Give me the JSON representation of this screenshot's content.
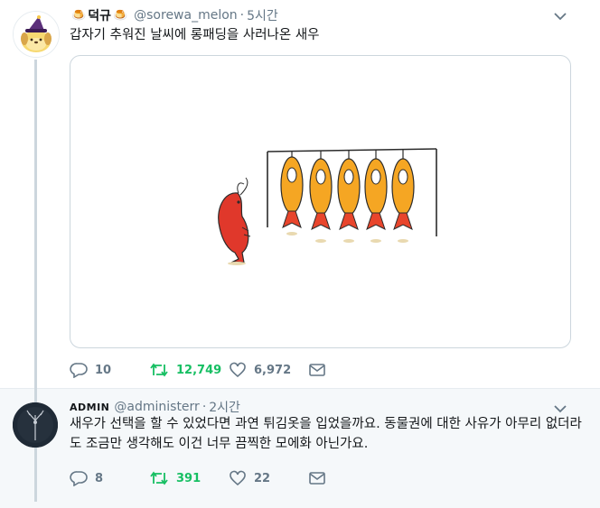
{
  "tweet1": {
    "emoji_left": "🍮",
    "name": "덕규",
    "emoji_right": "🍮",
    "handle": "@sorewa_melon",
    "separator": "·",
    "time": "5시간",
    "text": "갑자기 추워진 날씨에 롱패딩을 사러나온 새우",
    "replies": "10",
    "retweets": "12,749",
    "likes": "6,972",
    "retweet_color": "#17bf63"
  },
  "tweet2": {
    "name": "ADMIN",
    "handle": "@administerr",
    "separator": "·",
    "time": "2시간",
    "text": "새우가 선택을 할 수 있었다면 과연 튀김옷을 입었을까요. 동물권에 대한 사유가 아무리 없더라도 조금만 생각해도 이건 너무 끔찍한 모에화 아닌가요.",
    "replies": "8",
    "retweets": "391",
    "likes": "22"
  },
  "colors": {
    "accent_green": "#17bf63",
    "muted": "#657786",
    "thread_line": "#ccd6dd"
  }
}
